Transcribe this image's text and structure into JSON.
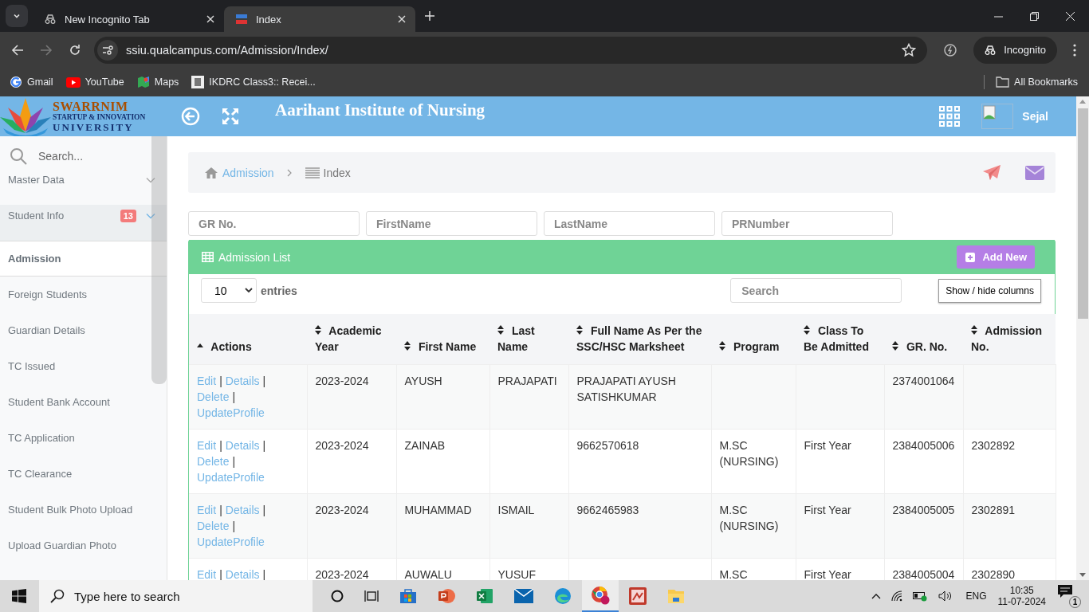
{
  "browser": {
    "tabs": [
      {
        "title": "New Incognito Tab",
        "selected": false
      },
      {
        "title": "Index",
        "selected": true
      }
    ],
    "url": "ssiu.qualcampus.com/Admission/Index/",
    "profile": "Incognito",
    "bookmarks": [
      {
        "label": "Gmail"
      },
      {
        "label": "YouTube"
      },
      {
        "label": "Maps"
      },
      {
        "label": "IKDRC Class3:: Recei..."
      }
    ],
    "all_bookmarks": "All Bookmarks"
  },
  "header": {
    "logo_lines": [
      "SWARRNIM",
      "STARTUP & INNOVATION",
      "UNIVERSITY"
    ],
    "title": "Aarihant Institute of Nursing",
    "user": "Sejal"
  },
  "sidebar": {
    "search_placeholder": "Search...",
    "items": [
      {
        "label": "Master Data",
        "kind": "group",
        "expanded": false,
        "selected": false
      },
      {
        "label": "Student Info",
        "kind": "group",
        "expanded": true,
        "selected": false,
        "badge": "13"
      },
      {
        "label": "Admission",
        "kind": "link",
        "selected": true
      },
      {
        "label": "Foreign Students",
        "kind": "link",
        "selected": false
      },
      {
        "label": "Guardian Details",
        "kind": "link",
        "selected": false
      },
      {
        "label": "TC Issued",
        "kind": "link",
        "selected": false
      },
      {
        "label": "Student Bank Account",
        "kind": "link",
        "selected": false
      },
      {
        "label": "TC Application",
        "kind": "link",
        "selected": false
      },
      {
        "label": "TC Clearance",
        "kind": "link",
        "selected": false
      },
      {
        "label": "Student Bulk Photo Upload",
        "kind": "link",
        "selected": false
      },
      {
        "label": "Upload Guardian Photo",
        "kind": "link",
        "selected": false
      }
    ]
  },
  "breadcrumb": [
    {
      "label": "Admission",
      "kind": "link"
    },
    {
      "label": "Index",
      "kind": "current"
    }
  ],
  "filters": [
    {
      "placeholder": "GR No."
    },
    {
      "placeholder": "FirstName"
    },
    {
      "placeholder": "LastName"
    },
    {
      "placeholder": "PRNumber"
    }
  ],
  "panel": {
    "title": "Admission List",
    "add_button": "Add New",
    "page_size": "10",
    "entries_label": "entries",
    "search_placeholder": "Search",
    "columns_button": "Show / hide columns"
  },
  "table": {
    "columns": [
      {
        "label": "Actions",
        "sorted_ascending": true
      },
      {
        "label": "Academic Year",
        "sorted_ascending": false
      },
      {
        "label": "First Name",
        "sorted_ascending": false
      },
      {
        "label": "Last Name",
        "sorted_ascending": false
      },
      {
        "label": "Full Name As Per the SSC/HSC Marksheet",
        "sorted_ascending": false
      },
      {
        "label": "Program",
        "sorted_ascending": false
      },
      {
        "label": "Class To Be Admitted",
        "sorted_ascending": false
      },
      {
        "label": "GR. No.",
        "sorted_ascending": false
      },
      {
        "label": "Admission No.",
        "sorted_ascending": false
      }
    ],
    "rows": [
      {
        "actions": [
          {
            "label": "Edit",
            "separator": "|"
          },
          {
            "label": "Details",
            "separator": "|"
          },
          {
            "label": "Delete",
            "separator": "|"
          },
          {
            "label": "UpdateProfile"
          }
        ],
        "academic_year": "2023-2024",
        "first_name": "AYUSH",
        "last_name": "PRAJAPATI",
        "full_name": "PRAJAPATI AYUSH SATISHKUMAR",
        "gr_no": "2374001064"
      },
      {
        "actions": [
          {
            "label": "Edit",
            "separator": "|"
          },
          {
            "label": "Details",
            "separator": "|"
          },
          {
            "label": "Delete",
            "separator": "|"
          },
          {
            "label": "UpdateProfile"
          }
        ],
        "academic_year": "2023-2024",
        "first_name": "ZAINAB",
        "full_name": "9662570618",
        "program": "M.SC (NURSING)",
        "class_to_be_admitted": "First Year",
        "gr_no": "2384005006",
        "admission_no": "2302892"
      },
      {
        "actions": [
          {
            "label": "Edit",
            "separator": "|"
          },
          {
            "label": "Details",
            "separator": "|"
          },
          {
            "label": "Delete",
            "separator": "|"
          },
          {
            "label": "UpdateProfile"
          }
        ],
        "academic_year": "2023-2024",
        "first_name": "MUHAMMAD",
        "last_name": "ISMAIL",
        "full_name": "9662465983",
        "program": "M.SC (NURSING)",
        "class_to_be_admitted": "First Year",
        "gr_no": "2384005005",
        "admission_no": "2302891"
      },
      {
        "actions": [
          {
            "label": "Edit",
            "separator": "|"
          },
          {
            "label": "Details",
            "separator": "|"
          }
        ],
        "academic_year": "2023-2024",
        "first_name": "AUWALU",
        "last_name": "YUSUF",
        "program": "M.SC",
        "class_to_be_admitted": "First Year",
        "gr_no": "2384005004",
        "admission_no": "2302890"
      }
    ]
  },
  "taskbar": {
    "search_placeholder": "Type here to search",
    "language": "ENG",
    "time": "10:35",
    "date": "11-07-2024",
    "notifications": "1"
  }
}
